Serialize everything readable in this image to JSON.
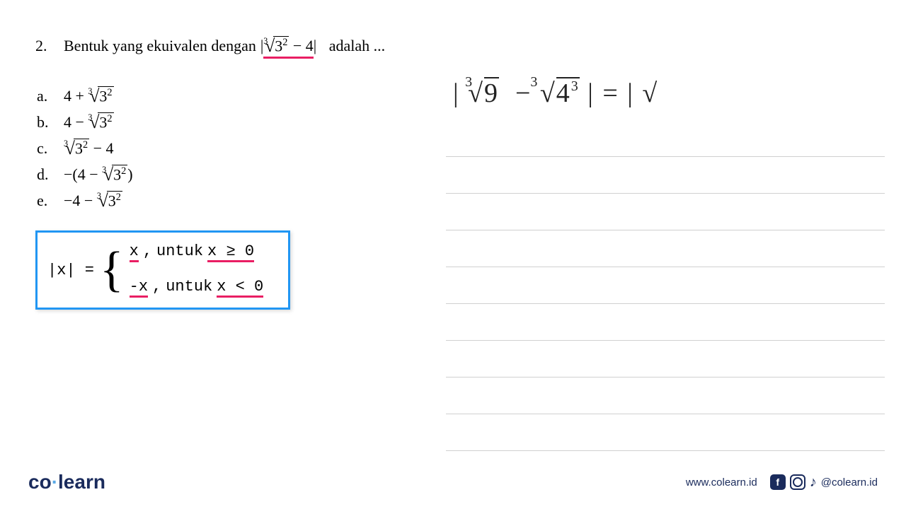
{
  "question": {
    "number": "2.",
    "text_before": "Bentuk yang ekuivalen dengan",
    "expression_abs_open": "|",
    "root_index": "3",
    "root_radicand_base": "3",
    "root_radicand_exp": "2",
    "minus4": "− 4",
    "expression_abs_close": "|",
    "text_after": "adalah ..."
  },
  "options": {
    "a": {
      "label": "a.",
      "prefix": "4 +",
      "root_idx": "3",
      "base": "3",
      "exp": "2"
    },
    "b": {
      "label": "b.",
      "prefix": "4 −",
      "root_idx": "3",
      "base": "3",
      "exp": "2"
    },
    "c": {
      "label": "c.",
      "root_idx": "3",
      "base": "3",
      "exp": "2",
      "suffix": "− 4"
    },
    "d": {
      "label": "d.",
      "prefix": "−(4 −",
      "root_idx": "3",
      "base": "3",
      "exp": "2",
      "suffix": ")"
    },
    "e": {
      "label": "e.",
      "prefix": "−4 −",
      "root_idx": "3",
      "base": "3",
      "exp": "2"
    }
  },
  "definition": {
    "lhs": "|x| =",
    "line1_x": "x",
    "line1_sep": ",",
    "line1_untuk": "untuk",
    "line1_cond": "x ≥ 0",
    "line2_x": "-x",
    "line2_sep": ",",
    "line2_untuk": "untuk",
    "line2_cond": "x < 0"
  },
  "handwriting": {
    "text": "| ∛9 − ∛4³ | = | √"
  },
  "footer": {
    "logo_co": "co",
    "logo_dot": "·",
    "logo_learn": "learn",
    "url": "www.colearn.id",
    "handle": "@colearn.id",
    "fb": "f"
  }
}
